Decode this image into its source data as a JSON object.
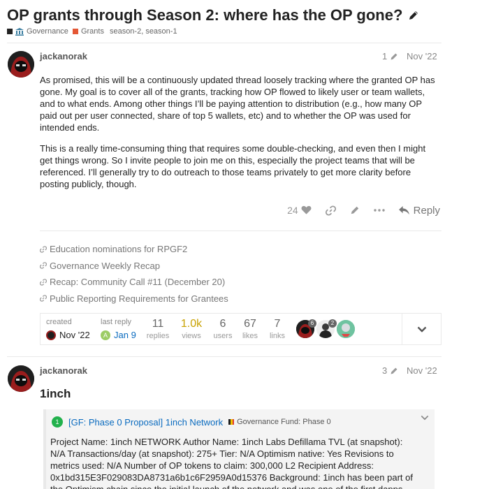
{
  "topic": {
    "title": "OP grants through Season 2: where has the OP gone?",
    "category_parent": "Governance",
    "category_child": "Grants",
    "tags": "season-2, season-1",
    "colors": {
      "governance": "#222222",
      "grants": "#e45735"
    }
  },
  "post1": {
    "username": "jackanorak",
    "edit_count": "1",
    "date": "Nov '22",
    "paragraphs": [
      "As promised, this will be a continuously updated thread loosely tracking where the granted OP has gone. My goal is to cover all of the grants, tracking how OP flowed to likely user or team wallets, and to what ends. Among other things I’ll be paying attention to distribution (e.g., how many OP paid out per user connected, share of top 5 wallets, etc) and to whether the OP was used for intended ends.",
      "This is a really time-consuming thing that requires some double-checking, and even then I might get things wrong. So I invite people to join me on this, especially the project teams that will be referenced. I’ll generally try to do outreach to those teams privately to get more clarity before posting publicly, though."
    ],
    "likes": "24",
    "reply_label": "Reply",
    "links": [
      "Education nominations for RPGF2",
      "Governance Weekly Recap",
      "Recap: Community Call #11 (December 20)",
      "Public Reporting Requirements for Grantees"
    ]
  },
  "topic_map": {
    "created_label": "created",
    "created_date": "Nov '22",
    "last_reply_label": "last reply",
    "last_reply_date": "Jan 9",
    "last_reply_avatar_letter": "A",
    "replies_num": "11",
    "replies_label": "replies",
    "views_num": "1.0k",
    "views_label": "views",
    "users_num": "6",
    "users_label": "users",
    "likes_num": "67",
    "likes_label": "likes",
    "links_num": "7",
    "links_label": "links",
    "participant_counts": [
      "6",
      "2"
    ]
  },
  "post2": {
    "username": "jackanorak",
    "edit_count": "3",
    "date": "Nov '22",
    "heading": "1inch",
    "onebox": {
      "badge": "1",
      "link": "[GF: Phase 0 Proposal] 1inch Network",
      "category": "Governance Fund: Phase 0",
      "text": "Project Name: 1inch NETWORK Author Name: 1inch Labs Defillama TVL (at snapshot): N/A Transactions/day (at snapshot): 275+ Tier: N/A Optimism native: Yes Revisions to metrics used: N/A Number of OP tokens to claim: 300,000 L2 Recipient Address: 0x1bd315E3F029083DA8731a6b1c6F2959A0d15376 Background: 1inch has been part of the Optimism chain since the initial launch of the network and was one of the first dapps deployed"
    }
  }
}
